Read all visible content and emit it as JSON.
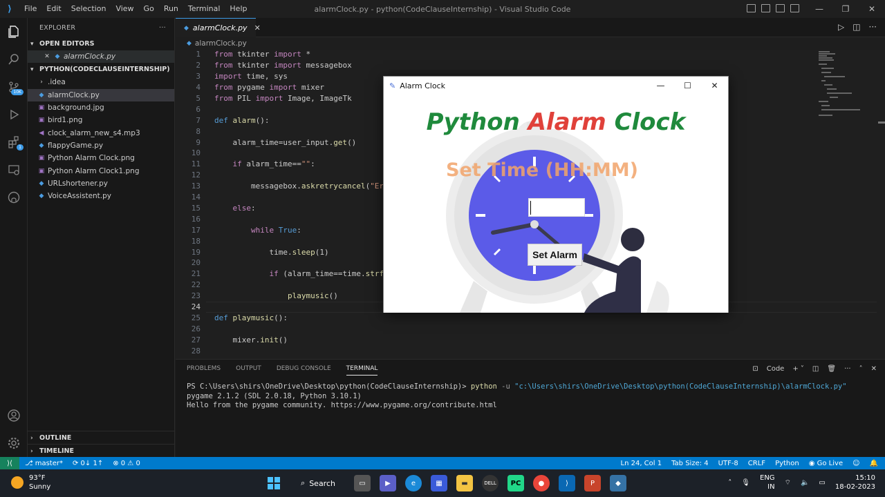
{
  "window": {
    "title": "alarmClock.py - python(CodeClauseInternship) - Visual Studio Code",
    "menu": [
      "File",
      "Edit",
      "Selection",
      "View",
      "Go",
      "Run",
      "Terminal",
      "Help"
    ],
    "controls": [
      "—",
      "❐",
      "✕"
    ]
  },
  "activity_bar": {
    "items": [
      "explorer-icon",
      "search-icon",
      "source-control-icon",
      "run-debug-icon",
      "extensions-icon",
      "remote-explorer-icon",
      "github-icon"
    ],
    "source_control_badge": "10K",
    "extensions_badge": "1"
  },
  "sidebar": {
    "header": "EXPLORER",
    "open_editors_title": "OPEN EDITORS",
    "open_editor_file": "alarmClock.py",
    "project_title": "PYTHON(CODECLAUSEINTERNSHIP)",
    "files": [
      {
        "name": ".idea",
        "icon": "folder"
      },
      {
        "name": "alarmClock.py",
        "icon": "python"
      },
      {
        "name": "background.jpg",
        "icon": "image"
      },
      {
        "name": "bird1.png",
        "icon": "image"
      },
      {
        "name": "clock_alarm_new_s4.mp3",
        "icon": "audio"
      },
      {
        "name": "flappyGame.py",
        "icon": "python"
      },
      {
        "name": "Python Alarm Clock.png",
        "icon": "image"
      },
      {
        "name": "Python Alarm Clock1.png",
        "icon": "image"
      },
      {
        "name": "URLshortener.py",
        "icon": "python"
      },
      {
        "name": "VoiceAssistent.py",
        "icon": "python"
      }
    ],
    "outline": "OUTLINE",
    "timeline": "TIMELINE"
  },
  "editor": {
    "tab_label": "alarmClock.py",
    "breadcrumb": "alarmClock.py",
    "line_numbers": [
      "1",
      "2",
      "3",
      "4",
      "5",
      "6",
      "7",
      "8",
      "9",
      "10",
      "11",
      "12",
      "13",
      "14",
      "15",
      "16",
      "17",
      "18",
      "19",
      "20",
      "21",
      "22",
      "23",
      "24",
      "25",
      "26",
      "27",
      "28"
    ],
    "lines": {
      "l1a": "from",
      "l1b": " tkinter ",
      "l1c": "import",
      "l1d": " *",
      "l2a": "from",
      "l2b": " tkinter ",
      "l2c": "import",
      "l2d": " messagebox",
      "l3a": "import",
      "l3b": " time, sys",
      "l4a": "from",
      "l4b": " pygame ",
      "l4c": "import",
      "l4d": " mixer",
      "l5a": "from",
      "l5b": " PIL ",
      "l5c": "import",
      "l5d": " Image, ImageTk",
      "l7a": "def",
      "l7b": " alarm",
      "l7c": "():",
      "l9a": "    alarm_time=user_input.",
      "l9b": "get",
      "l9c": "()",
      "l11a": "    ",
      "l11b": "if",
      "l11c": " alarm_time==",
      "l11d": "\"\"",
      "l11e": ":",
      "l13a": "        messagebox.",
      "l13b": "askretrycancel",
      "l13c": "(",
      "l13d": "\"Err",
      "l15a": "    ",
      "l15b": "else",
      "l15c": ":",
      "l17a": "        ",
      "l17b": "while",
      "l17c": " ",
      "l17d": "True",
      "l17e": ":",
      "l19a": "            time.",
      "l19b": "sleep",
      "l19c": "(1)",
      "l21a": "            ",
      "l21b": "if",
      "l21c": " (alarm_time==time.",
      "l21d": "strft",
      "l23a": "                ",
      "l23b": "playmusic",
      "l23c": "()",
      "l25a": "def",
      "l25b": " playmusic",
      "l25c": "():",
      "l27a": "    mixer.",
      "l27b": "init",
      "l27c": "()"
    }
  },
  "panel": {
    "tabs": [
      "PROBLEMS",
      "OUTPUT",
      "DEBUG CONSOLE",
      "TERMINAL"
    ],
    "active_tab": "TERMINAL",
    "profile": "Code",
    "terminal_prompt": "PS C:\\Users\\shirs\\OneDrive\\Desktop\\python(CodeClauseInternship)> ",
    "terminal_cmd": "python",
    "terminal_flag": " -u ",
    "terminal_path": "\"c:\\Users\\shirs\\OneDrive\\Desktop\\python(CodeClauseInternship)\\alarmClock.py\"",
    "terminal_line2": "pygame 2.1.2 (SDL 2.0.18, Python 3.10.1)",
    "terminal_line3": "Hello from the pygame community. https://www.pygame.org/contribute.html"
  },
  "statusbar": {
    "branch": "master*",
    "sync": "0↓ 1↑",
    "problems": "⊗ 0 ⚠ 0",
    "position": "Ln 24, Col 1",
    "tab_size": "Tab Size: 4",
    "encoding": "UTF-8",
    "eol": "CRLF",
    "language": "Python",
    "golive": "Go Live"
  },
  "alarm_window": {
    "title": "Alarm Clock",
    "headline_1": "Python",
    "headline_2": " Alarm",
    "headline_3": " Clock",
    "subtitle": "Set Time (HH:MM)",
    "input_value": "",
    "button_label": "Set Alarm",
    "colors": {
      "green": "#1f8a3c",
      "red": "#e0413a",
      "clock_face": "#5b5be8",
      "orange": "#f2a46a"
    }
  },
  "taskbar": {
    "temperature": "93°F",
    "weather": "Sunny",
    "search_label": "Search",
    "lang_1": "ENG",
    "lang_2": "IN",
    "time": "15:10",
    "date": "18-02-2023"
  }
}
